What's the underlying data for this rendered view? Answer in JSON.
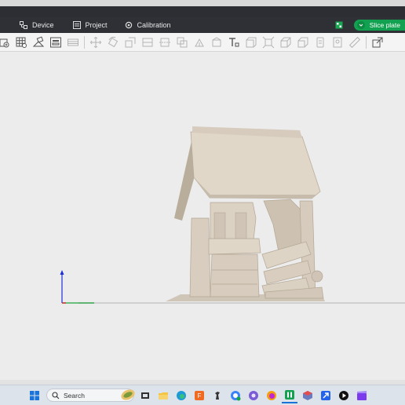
{
  "tabs": [
    {
      "label": "Device",
      "icon": "device-icon"
    },
    {
      "label": "Project",
      "icon": "project-icon"
    },
    {
      "label": "Calibration",
      "icon": "calibration-icon"
    }
  ],
  "slice_button": {
    "label": "Slice plate"
  },
  "taskbar": {
    "search_placeholder": "Search"
  },
  "colors": {
    "titlebar": "#2c2e33",
    "accent": "#12a150",
    "viewport": "#ececec",
    "model": "#d9cfc1",
    "axis_z": "#1f2fd6",
    "axis_y": "#1aa53a",
    "axis_x": "#d42020"
  }
}
